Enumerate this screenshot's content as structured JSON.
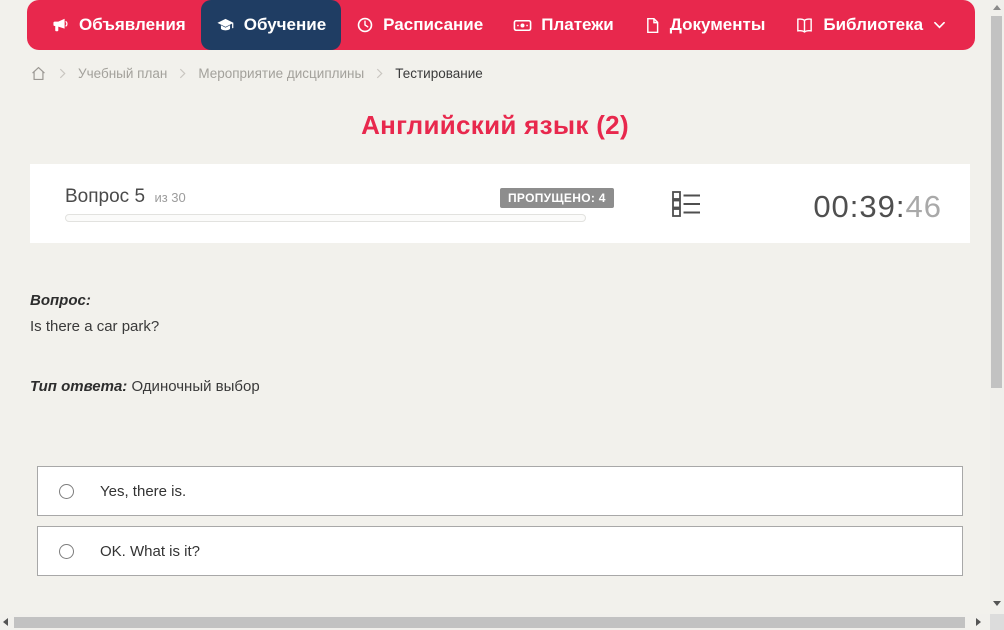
{
  "colors": {
    "page_background": "#f2f1ec",
    "accent_red": "#e8284d",
    "accent_navy": "#1f3d63",
    "badge_gray": "#8d8d8d"
  },
  "nav": {
    "items": [
      {
        "label": "Объявления",
        "icon": "megaphone-icon",
        "active": false
      },
      {
        "label": "Обучение",
        "icon": "graduation-cap-icon",
        "active": true
      },
      {
        "label": "Расписание",
        "icon": "clock-icon",
        "active": false
      },
      {
        "label": "Платежи",
        "icon": "banknote-icon",
        "active": false
      },
      {
        "label": "Документы",
        "icon": "document-icon",
        "active": false
      },
      {
        "label": "Библиотека",
        "icon": "book-icon",
        "active": false,
        "has_dropdown": true
      }
    ]
  },
  "breadcrumb": {
    "items": [
      "Учебный план",
      "Мероприятие дисциплины",
      "Тестирование"
    ]
  },
  "title": "Английский язык (2)",
  "quiz": {
    "question_label": "Вопрос 5",
    "question_of": "из 30",
    "skipped_badge": "ПРОПУЩЕНО: 4",
    "progress_percent": 0,
    "timer": {
      "main": "00:39:",
      "seconds": "46"
    }
  },
  "question": {
    "label": "Вопрос:",
    "text": "Is there a car park?",
    "type_label": "Тип ответа:",
    "type_value": "Одиночный выбор"
  },
  "answers": {
    "options": [
      {
        "label": "Yes, there is.",
        "selected": false
      },
      {
        "label": "OK. What is it?",
        "selected": false
      }
    ]
  },
  "icons": {
    "megaphone-icon": "📣",
    "graduation-cap-icon": "🎓",
    "clock-icon": "🕐",
    "banknote-icon": "💵",
    "document-icon": "📄",
    "book-icon": "📖",
    "chevron-down-icon": "⌄",
    "home-icon": "⌂",
    "breadcrumb-chevron-icon": "›",
    "question-list-icon": "☷",
    "radio-unchecked-icon": "○",
    "scroll-up-icon": "▲",
    "scroll-down-icon": "▼",
    "scroll-left-icon": "◀",
    "scroll-right-icon": "▶"
  }
}
